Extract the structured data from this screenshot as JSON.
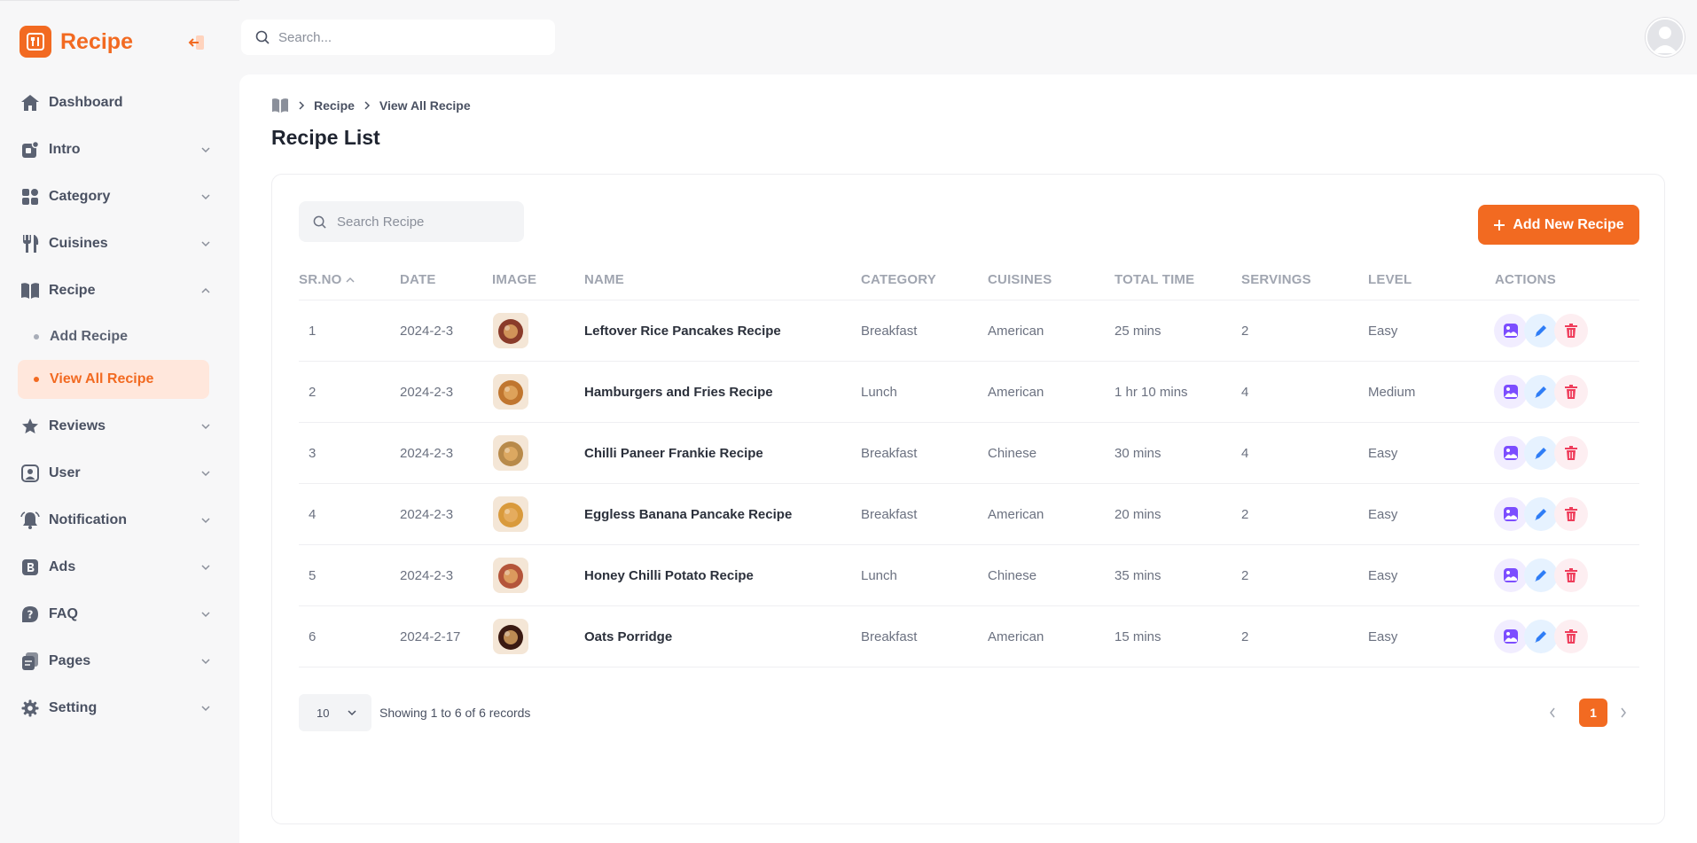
{
  "brand": {
    "name": "Recipe",
    "accent": "#f26a21"
  },
  "topbar": {
    "search_placeholder": "Search..."
  },
  "sidebar": {
    "items": [
      {
        "label": "Dashboard",
        "icon": "home-icon"
      },
      {
        "label": "Intro",
        "icon": "intro-icon"
      },
      {
        "label": "Category",
        "icon": "category-grid-icon"
      },
      {
        "label": "Cuisines",
        "icon": "fork-knife-icon"
      },
      {
        "label": "Recipe",
        "icon": "book-icon",
        "expanded": true,
        "children": [
          {
            "label": "Add Recipe"
          },
          {
            "label": "View All Recipe",
            "active": true
          }
        ]
      },
      {
        "label": "Reviews",
        "icon": "star-icon"
      },
      {
        "label": "User",
        "icon": "user-icon"
      },
      {
        "label": "Notification",
        "icon": "bell-icon"
      },
      {
        "label": "Ads",
        "icon": "ads-icon"
      },
      {
        "label": "FAQ",
        "icon": "question-icon"
      },
      {
        "label": "Pages",
        "icon": "pages-icon"
      },
      {
        "label": "Setting",
        "icon": "gear-icon"
      }
    ]
  },
  "breadcrumb": {
    "items": [
      "Recipe",
      "View All Recipe"
    ]
  },
  "page": {
    "title": "Recipe List"
  },
  "table": {
    "search_placeholder": "Search Recipe",
    "add_button": "Add New Recipe",
    "columns": [
      "SR.NO",
      "DATE",
      "IMAGE",
      "NAME",
      "CATEGORY",
      "CUISINES",
      "TOTAL TIME",
      "SERVINGS",
      "LEVEL",
      "ACTIONS"
    ],
    "rows": [
      {
        "sr": "1",
        "date": "2024-2-3",
        "name": "Leftover Rice Pancakes Recipe",
        "category": "Breakfast",
        "cuisine": "American",
        "time": "25 mins",
        "servings": "2",
        "level": "Easy"
      },
      {
        "sr": "2",
        "date": "2024-2-3",
        "name": "Hamburgers and Fries Recipe",
        "category": "Lunch",
        "cuisine": "American",
        "time": "1 hr 10 mins",
        "servings": "4",
        "level": "Medium"
      },
      {
        "sr": "3",
        "date": "2024-2-3",
        "name": "Chilli Paneer Frankie Recipe",
        "category": "Breakfast",
        "cuisine": "Chinese",
        "time": "30 mins",
        "servings": "4",
        "level": "Easy"
      },
      {
        "sr": "4",
        "date": "2024-2-3",
        "name": "Eggless Banana Pancake Recipe",
        "category": "Breakfast",
        "cuisine": "American",
        "time": "20 mins",
        "servings": "2",
        "level": "Easy"
      },
      {
        "sr": "5",
        "date": "2024-2-3",
        "name": "Honey Chilli Potato Recipe",
        "category": "Lunch",
        "cuisine": "Chinese",
        "time": "35 mins",
        "servings": "2",
        "level": "Easy"
      },
      {
        "sr": "6",
        "date": "2024-2-17",
        "name": "Oats Porridge",
        "category": "Breakfast",
        "cuisine": "American",
        "time": "15 mins",
        "servings": "2",
        "level": "Easy"
      }
    ],
    "thumb_colors": [
      "#8a3b2a",
      "#c0762f",
      "#b88a4a",
      "#d99a3c",
      "#b4553a",
      "#3a1a12"
    ]
  },
  "pagination": {
    "per_page": "10",
    "showing": "Showing 1 to 6 of 6 records",
    "current_page": "1"
  }
}
